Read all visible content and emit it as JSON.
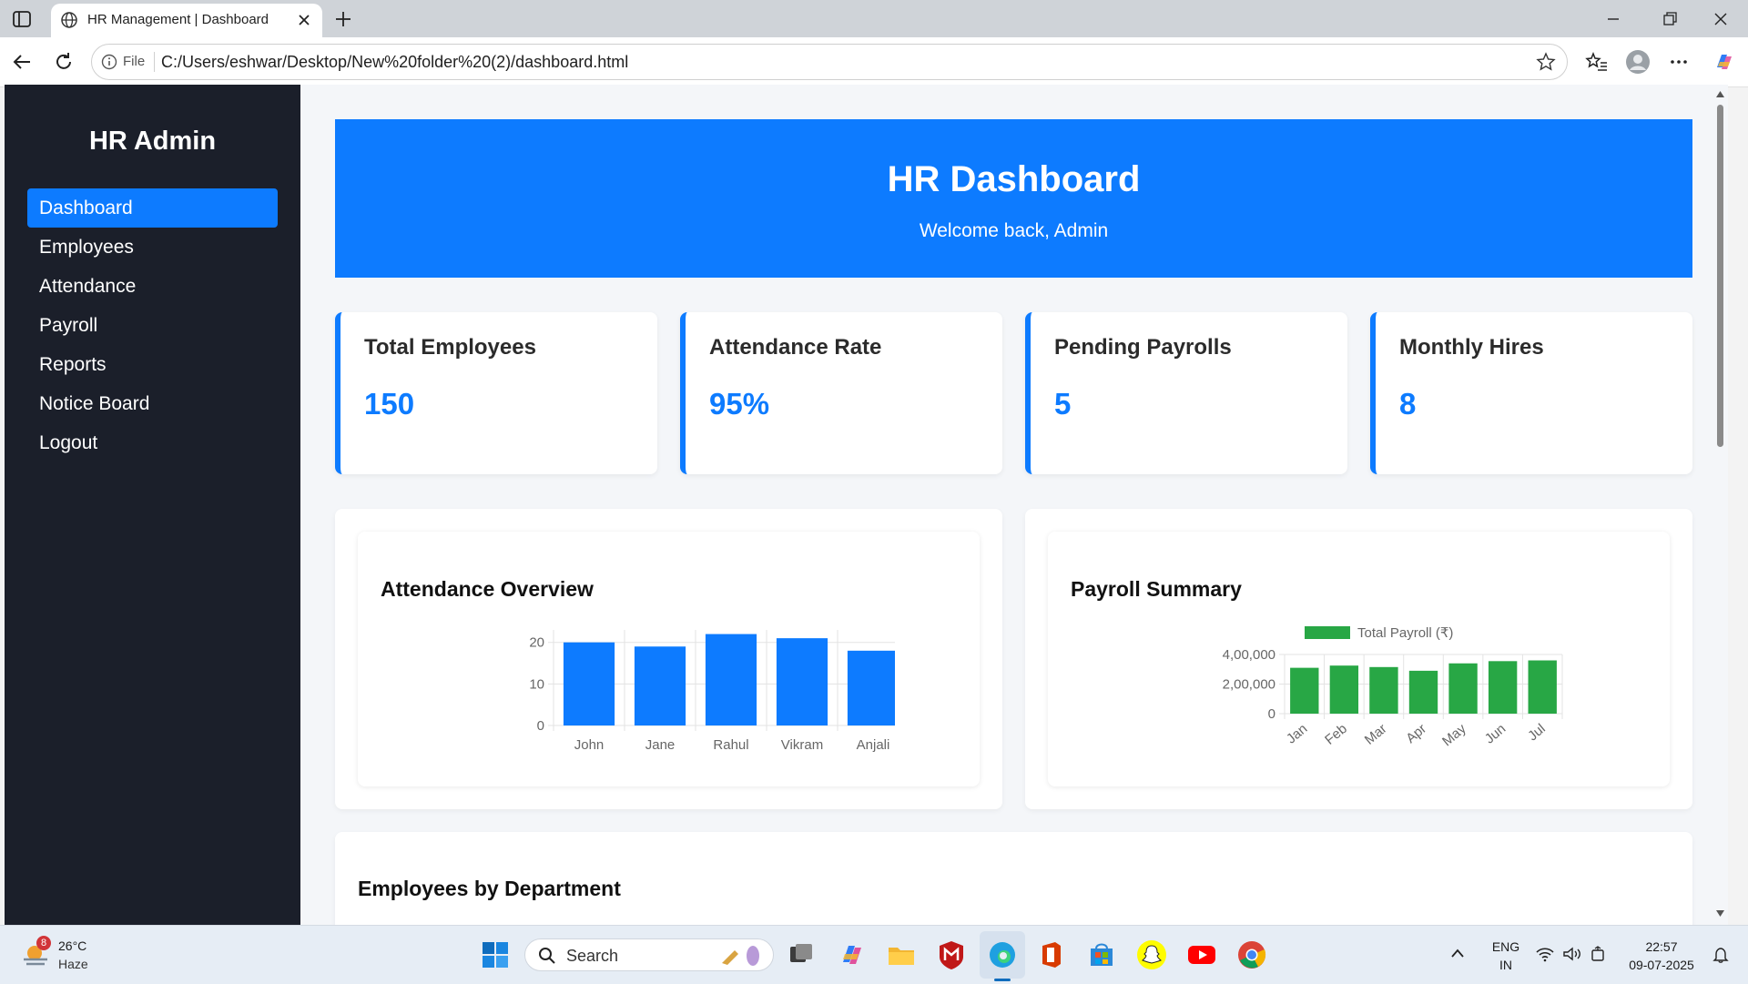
{
  "browser": {
    "tab_title": "HR Management | Dashboard",
    "url_scheme_label": "File",
    "url": "C:/Users/eshwar/Desktop/New%20folder%20(2)/dashboard.html"
  },
  "sidebar": {
    "brand": "HR Admin",
    "items": [
      {
        "label": "Dashboard",
        "active": true
      },
      {
        "label": "Employees",
        "active": false
      },
      {
        "label": "Attendance",
        "active": false
      },
      {
        "label": "Payroll",
        "active": false
      },
      {
        "label": "Reports",
        "active": false
      },
      {
        "label": "Notice Board",
        "active": false
      },
      {
        "label": "Logout",
        "active": false
      }
    ]
  },
  "hero": {
    "title": "HR Dashboard",
    "subtitle": "Welcome back, Admin"
  },
  "stats": [
    {
      "label": "Total Employees",
      "value": "150"
    },
    {
      "label": "Attendance Rate",
      "value": "95%"
    },
    {
      "label": "Pending Payrolls",
      "value": "5"
    },
    {
      "label": "Monthly Hires",
      "value": "8"
    }
  ],
  "sections": {
    "attendance_title": "Attendance Overview",
    "payroll_title": "Payroll Summary",
    "department_title": "Employees by Department"
  },
  "colors": {
    "accent": "#0d7bff",
    "sidebar_bg": "#1b1f2a",
    "payroll_green": "#28a745"
  },
  "chart_data": [
    {
      "type": "bar",
      "title": "Attendance Overview",
      "categories": [
        "John",
        "Jane",
        "Rahul",
        "Vikram",
        "Anjali"
      ],
      "values": [
        20,
        19,
        22,
        21,
        18
      ],
      "yticks": [
        "0",
        "10",
        "20"
      ],
      "ylim": [
        0,
        23
      ],
      "legend": "none",
      "grid": true
    },
    {
      "type": "bar",
      "title": "Payroll Summary",
      "categories": [
        "Jan",
        "Feb",
        "Mar",
        "Apr",
        "May",
        "Jun",
        "Jul"
      ],
      "series": [
        {
          "name": "Total Payroll (₹)",
          "values": [
            310000,
            325000,
            315000,
            290000,
            340000,
            355000,
            360000
          ]
        }
      ],
      "yticks": [
        "0",
        "2,00,000",
        "4,00,000"
      ],
      "ylim": [
        0,
        400000
      ],
      "legend": "top",
      "grid": true
    }
  ],
  "taskbar": {
    "weather_temp": "26°C",
    "weather_cond": "Haze",
    "weather_badge": "8",
    "search_label": "Search",
    "lang_top": "ENG",
    "lang_bottom": "IN",
    "time": "22:57",
    "date": "09-07-2025"
  }
}
